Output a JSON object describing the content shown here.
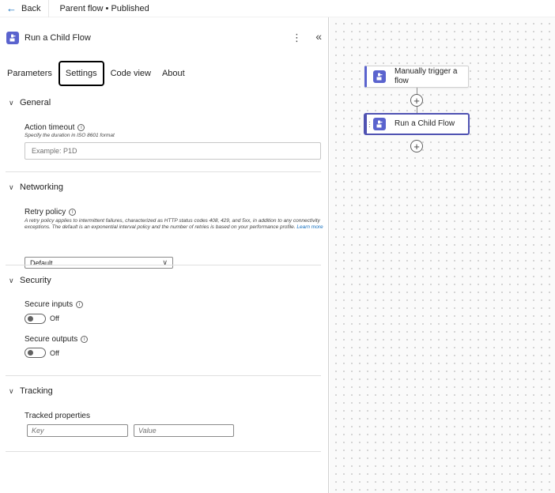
{
  "topbar": {
    "back_label": "Back",
    "flow_title": "Parent flow • Published"
  },
  "panel": {
    "title": "Run a Child Flow",
    "tabs": [
      {
        "label": "Parameters",
        "active": false
      },
      {
        "label": "Settings",
        "active": true
      },
      {
        "label": "Code view",
        "active": false
      },
      {
        "label": "About",
        "active": false
      }
    ],
    "sections": {
      "general": {
        "title": "General",
        "action_timeout_label": "Action timeout",
        "action_timeout_helper": "Specify the duration in ISO 8601 format",
        "action_timeout_placeholder": "Example: P1D"
      },
      "networking": {
        "title": "Networking",
        "retry_policy_label": "Retry policy",
        "retry_policy_helper": "A retry policy applies to intermittent failures, characterized as HTTP status codes 408, 429, and 5xx, in addition to any connectivity exceptions. The default is an exponential interval policy and the number of retries is based on your performance profile.",
        "learn_more": "Learn more",
        "retry_policy_value": "Default"
      },
      "security": {
        "title": "Security",
        "secure_inputs_label": "Secure inputs",
        "secure_inputs_state": "Off",
        "secure_outputs_label": "Secure outputs",
        "secure_outputs_state": "Off"
      },
      "tracking": {
        "title": "Tracking",
        "tracked_properties_label": "Tracked properties",
        "key_placeholder": "Key",
        "value_placeholder": "Value"
      }
    }
  },
  "canvas": {
    "nodes": [
      {
        "label": "Manually trigger a flow",
        "icon": "child-flow-icon"
      },
      {
        "label": "Run a Child Flow",
        "icon": "child-flow-icon",
        "selected": true
      }
    ]
  },
  "colors": {
    "accent": "#5a63ce",
    "link": "#0f6cbd"
  }
}
